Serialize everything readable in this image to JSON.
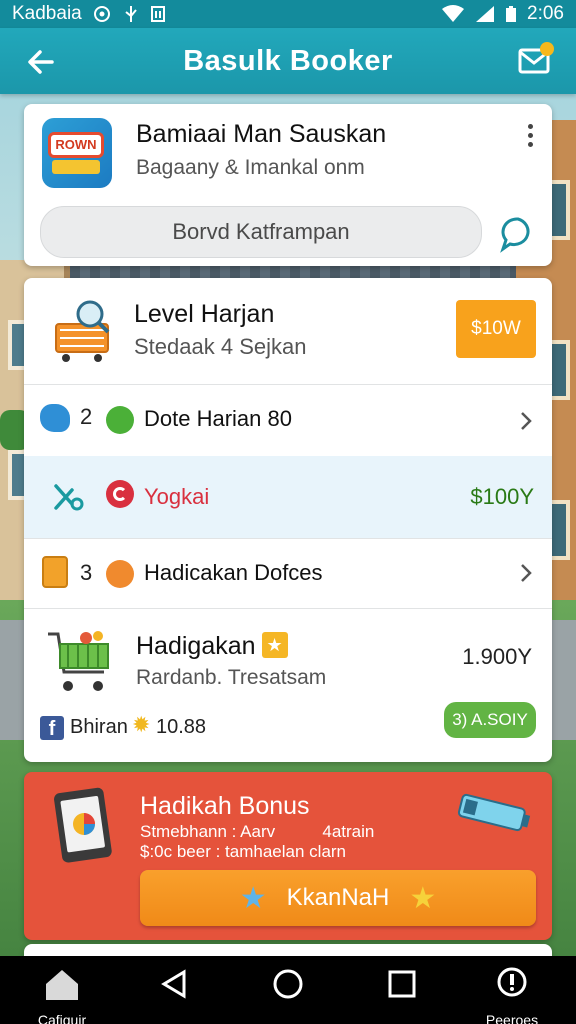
{
  "status_bar": {
    "carrier": "Kadbaia",
    "time": "2:06"
  },
  "app_bar": {
    "title": "Basulk Booker"
  },
  "profile_card": {
    "name": "Bamiaai Man Sauskan",
    "subtitle": "Bagaany & Imankal onm",
    "search_placeholder": "Borvd Katframpan"
  },
  "level_card": {
    "title": "Level Harjan",
    "subtitle": "Stedaak 4 Sejkan",
    "price_button": "$10W",
    "rows": [
      {
        "number": "2",
        "label": "Dote Harian 80"
      },
      {
        "label": "Yogkai",
        "value": "$100Y"
      },
      {
        "number": "3",
        "label": "Hadicakan Dofces"
      }
    ],
    "item": {
      "title": "Hadigakan",
      "subtitle": "Rardanb. Tresatsam",
      "price": "1.900Y",
      "social_label": "Bhiran",
      "social_value": "10.88",
      "green_button": "3) A.SOIY"
    }
  },
  "bonus_card": {
    "title": "Hadikah Bonus",
    "line1": "Stmebhann : Aarv          4atrain",
    "line2": "$:0c beer : tamhaelan clarn",
    "button": "KkanNaH"
  },
  "nav": {
    "home_label": "Cafiquir",
    "info_label": "Peeroes"
  },
  "colors": {
    "primary": "#1b97aa",
    "orange": "#f8a21c",
    "bonus_red": "#e5533b",
    "green": "#62b444"
  }
}
